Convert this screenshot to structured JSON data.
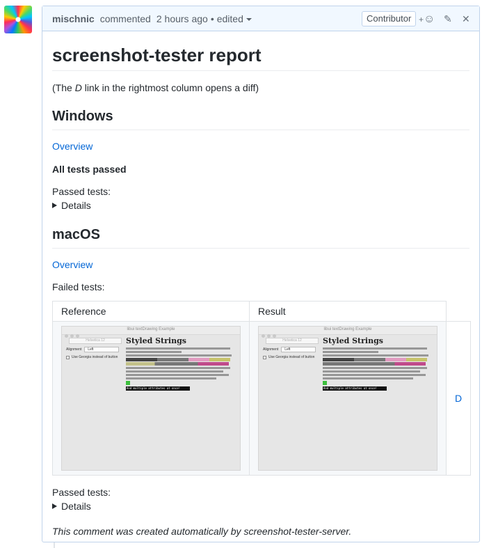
{
  "header": {
    "author": "mischnic",
    "action": "commented",
    "time": "2 hours ago",
    "bullet": "•",
    "edited": "edited",
    "badge": "Contributor",
    "reaction_plus": "+",
    "reaction_icon": "☺",
    "edit_icon": "✎",
    "close_icon": "✕"
  },
  "report": {
    "title": "screenshot-tester report",
    "intro_prefix": "(The ",
    "intro_letter": "D",
    "intro_suffix": " link in the rightmost column opens a diff)",
    "windows": {
      "heading": "Windows",
      "overview": "Overview",
      "status": "All tests passed",
      "passed_label": "Passed tests:",
      "details": "Details"
    },
    "macos": {
      "heading": "macOS",
      "overview": "Overview",
      "failed_label": "Failed tests:",
      "table": {
        "col_reference": "Reference",
        "col_result": "Result",
        "diff_link": "D"
      },
      "passed_label": "Passed tests:",
      "details": "Details"
    },
    "footer": "This comment was created automatically by screenshot-tester-server."
  },
  "thumbnail": {
    "window_title": "libui textDrawing Example",
    "font_box": "Helvetica 12",
    "alignment_label": "Alignment",
    "alignment_value": "Left",
    "checkbox_label": "Use Georgia instead of button",
    "heading": "Styled Strings",
    "last_line": "And multiple attributes at once!"
  }
}
